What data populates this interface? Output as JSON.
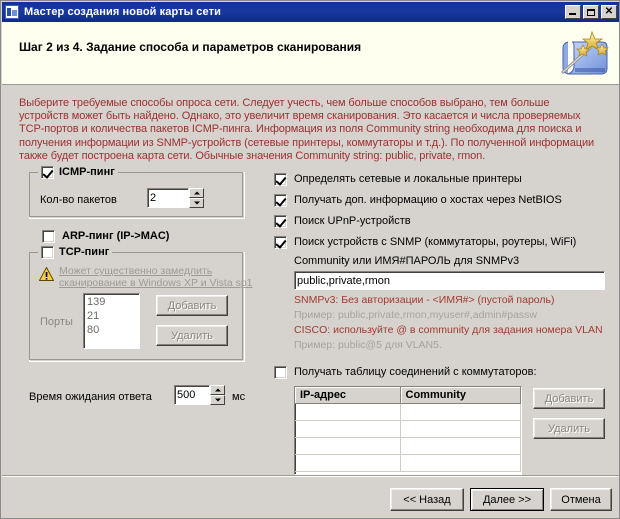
{
  "window": {
    "title": "Мастер создания новой карты сети",
    "icon": "network-map-icon",
    "controls": {
      "minimize": "minimize-icon",
      "maximize": "maximize-icon",
      "close": "✕"
    }
  },
  "header": {
    "step_title": "Шаг 2 из 4. Задание способа и параметров сканирования",
    "icon": "wizard-wand-scroll-icon"
  },
  "description": {
    "lines": [
      "Выберите требуемые способы опроса сети. Следует учесть, чем больше способов выбрано, тем больше",
      "устройств может быть найдено. Однако, это увеличит время сканирования. Это касается и числа проверяемых",
      "TCP-портов и количества пакетов ICMP-пинга. Информация из поля Community string необходима для поиска и",
      "получения информации из SNMP-устройств (сетевые принтеры, коммутаторы и т.д.). По полученной информации",
      "также будет построена карта сети. Обычные значения Community string: public, private, rmon."
    ]
  },
  "left_panel": {
    "icmp_group": {
      "legend": "ICMP-пинг",
      "checked": true,
      "packets_label": "Кол-во пакетов",
      "packets_value": "2"
    },
    "arp_ping": {
      "label": "ARP-пинг (IP->MAC)",
      "checked": false
    },
    "tcp_group": {
      "legend": "TCP-пинг",
      "checked": false,
      "disabled": true,
      "warning_icon": "warning-triangle-icon",
      "warning_line1": "Может существенно замедлить",
      "warning_line2": "сканирование в Windows XP и Vista sp1",
      "ports_label": "Порты",
      "ports": [
        "139",
        "21",
        "80"
      ],
      "add_button": "Добавить",
      "remove_button": "Удалить"
    },
    "timeout": {
      "label": "Время ожидания ответа",
      "value": "500",
      "units": "мс"
    }
  },
  "right_panel": {
    "options": [
      {
        "label": "Определять сетевые и локальные принтеры",
        "checked": true
      },
      {
        "label": "Получать доп. информацию о хостах через NetBIOS",
        "checked": true
      },
      {
        "label": "Поиск UPnP-устройств",
        "checked": true
      },
      {
        "label": "Поиск устройств с SNMP (коммутаторы, роутеры, WiFi)",
        "checked": true
      }
    ],
    "community": {
      "label": "Community или ИМЯ#ПАРОЛЬ для SNMPv3",
      "value": "public,private,rmon",
      "hint_snmpv3": "SNMPv3: Без авторизации - <ИМЯ#> (пустой пароль)",
      "hint_snmpv3_example": "Пример: public,private,rmon,myuser#,admin#passw",
      "hint_cisco": "CISCO: используйте @ в community для задания номера VLAN",
      "hint_cisco_example": "Пример: public@5 для VLAN5."
    },
    "switch_table": {
      "checkbox_label": "Получать таблицу соединений с коммутаторов:",
      "checked": false,
      "columns": [
        "IP-адрес",
        "Community"
      ],
      "rows": [
        [
          "",
          ""
        ],
        [
          "",
          ""
        ],
        [
          "",
          ""
        ],
        [
          "",
          ""
        ]
      ],
      "add_button": "Добавить",
      "remove_button": "Удалить"
    }
  },
  "footer": {
    "back_button": "<< Назад",
    "next_button": "Далее >>",
    "cancel_button": "Отмена"
  },
  "colors": {
    "titlebar": "#11309c",
    "header_bg": "#fffff0",
    "body_bg": "#d6d3ce",
    "description_text": "#9c3030",
    "hint_red": "#a03a30",
    "hint_gray": "#a6a39e",
    "disabled_text": "#8a8680"
  }
}
